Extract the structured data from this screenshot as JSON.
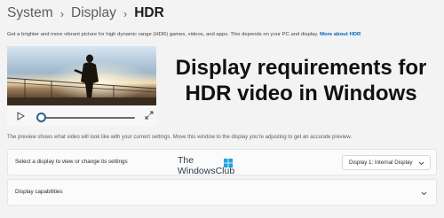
{
  "breadcrumb": {
    "items": [
      "System",
      "Display",
      "HDR"
    ],
    "separator": "›"
  },
  "description": {
    "text": "Get a brighter and more vibrant picture for high dynamic range (HDR) games, videos, and apps. This depends on your PC and display.",
    "link": "More about HDR"
  },
  "video": {
    "progress_fraction": 0.02,
    "icons": {
      "play": "play-icon",
      "expand": "expand-icon"
    }
  },
  "headline": {
    "line1": "Display requirements for",
    "line2": "HDR video in Windows"
  },
  "preview_note": "The preview shows what video will look like with your current settings. Move this window to the display you're adjusting to get an accurate preview.",
  "display_row": {
    "label": "Select a display to view or change its settings",
    "selected": "Display 1: Internal Display"
  },
  "capabilities_row": {
    "label": "Display capabilities"
  },
  "watermark": {
    "line1": "The",
    "line2": "WindowsClub"
  },
  "colors": {
    "accent": "#0064b4",
    "background": "#f3f3f3",
    "card": "#fbfbfb"
  }
}
